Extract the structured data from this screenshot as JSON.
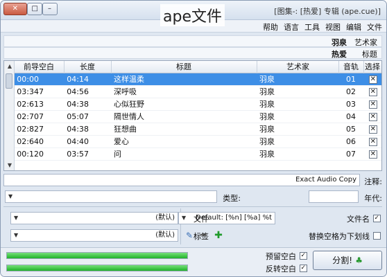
{
  "window": {
    "title": "[图集-: [热爱] 专辑 (ape.cue)]",
    "buttons": {
      "minimize": "–",
      "maximize": "□",
      "close": "✕"
    }
  },
  "menu": [
    "文件",
    "编辑",
    "视图",
    "工具",
    "语言",
    "帮助"
  ],
  "info": {
    "artist_label": "艺术家",
    "artist_value": "羽泉",
    "title_label": "标题",
    "title_value": "热爱"
  },
  "table": {
    "headers": [
      "选择",
      "音轨",
      "艺术家",
      "标题",
      "长度",
      "前导空白"
    ],
    "rows": [
      {
        "track": "01",
        "artist": "羽泉",
        "title": "这样温柔",
        "length": "04:14",
        "gap": "00:00"
      },
      {
        "track": "02",
        "artist": "羽泉",
        "title": "深呼吸",
        "length": "04:56",
        "gap": "03:347"
      },
      {
        "track": "03",
        "artist": "羽泉",
        "title": "心似狂野",
        "length": "04:38",
        "gap": "02:613"
      },
      {
        "track": "04",
        "artist": "羽泉",
        "title": "隔世情人",
        "length": "05:07",
        "gap": "02:707"
      },
      {
        "track": "05",
        "artist": "羽泉",
        "title": "狂想曲",
        "length": "04:38",
        "gap": "02:827"
      },
      {
        "track": "06",
        "artist": "羽泉",
        "title": "爱心",
        "length": "04:40",
        "gap": "02:640"
      },
      {
        "track": "07",
        "artist": "羽泉",
        "title": "问",
        "length": "03:57",
        "gap": "00:120"
      }
    ],
    "selected_index": 0
  },
  "comment": {
    "label": "注释:",
    "value": "Exact Audio Copy"
  },
  "year": {
    "label": "年代:",
    "value": ""
  },
  "genre": {
    "label": "类型:",
    "value": ""
  },
  "naming": {
    "filename_label": "文件名",
    "filename_value": "Default: [%n] [%a] %t",
    "replace_label": "替换空格为下划线"
  },
  "output": {
    "file_label": "文件",
    "file_value": "(默认)",
    "tag_label": "标签",
    "tag_value": "(默认)"
  },
  "bottom": {
    "split_label": "分割!",
    "gap1_label": "预留空白",
    "gap2_label": "反转空白",
    "progress1": 1.0,
    "progress2": 1.0
  },
  "caption": "ape文件"
}
